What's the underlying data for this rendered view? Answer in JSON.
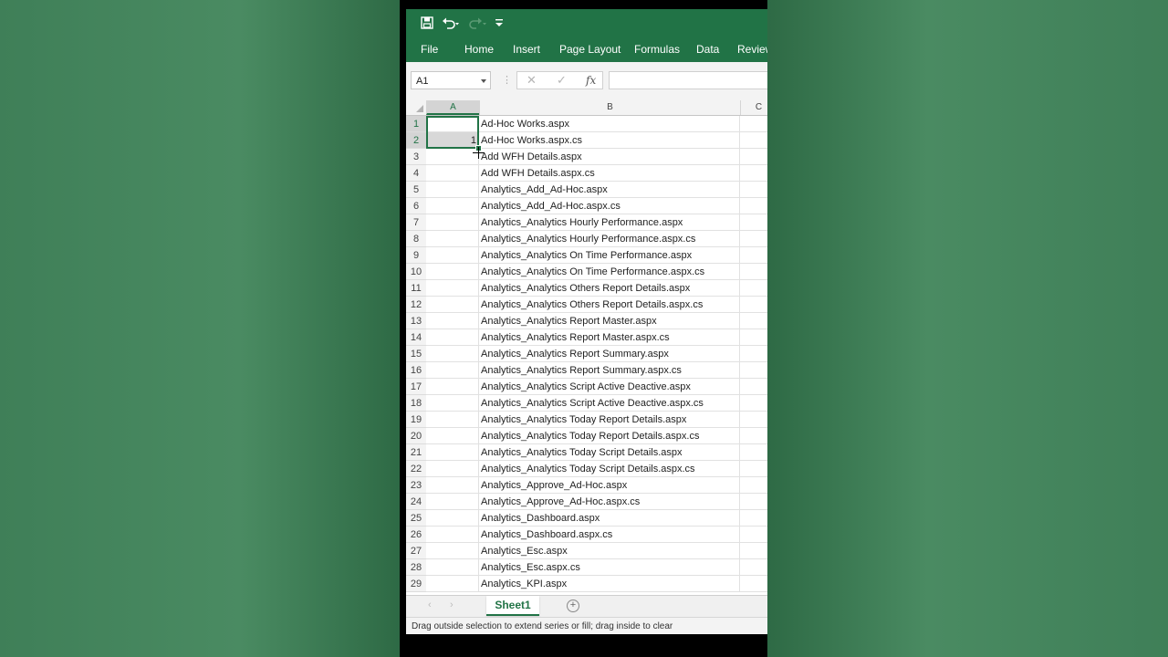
{
  "quick_access": {
    "icons": [
      "save-icon",
      "undo-icon",
      "redo-icon",
      "customize-icon"
    ]
  },
  "ribbon": {
    "tabs": [
      "File",
      "Home",
      "Insert",
      "Page Layout",
      "Formulas",
      "Data",
      "Review"
    ]
  },
  "formula_bar": {
    "name_box": "A1",
    "cancel_symbol": "✕",
    "enter_symbol": "✓",
    "fx_symbol": "fx",
    "formula_value": ""
  },
  "columns": [
    "A",
    "B",
    "C"
  ],
  "rows": [
    {
      "num": "1",
      "a": "",
      "b": "Ad-Hoc Works.aspx"
    },
    {
      "num": "2",
      "a": "1",
      "b": "Ad-Hoc Works.aspx.cs"
    },
    {
      "num": "3",
      "a": "",
      "b": "Add WFH Details.aspx"
    },
    {
      "num": "4",
      "a": "",
      "b": "Add WFH Details.aspx.cs"
    },
    {
      "num": "5",
      "a": "",
      "b": "Analytics_Add_Ad-Hoc.aspx"
    },
    {
      "num": "6",
      "a": "",
      "b": "Analytics_Add_Ad-Hoc.aspx.cs"
    },
    {
      "num": "7",
      "a": "",
      "b": "Analytics_Analytics Hourly Performance.aspx"
    },
    {
      "num": "8",
      "a": "",
      "b": "Analytics_Analytics Hourly Performance.aspx.cs"
    },
    {
      "num": "9",
      "a": "",
      "b": "Analytics_Analytics On Time Performance.aspx"
    },
    {
      "num": "10",
      "a": "",
      "b": "Analytics_Analytics On Time Performance.aspx.cs"
    },
    {
      "num": "11",
      "a": "",
      "b": "Analytics_Analytics Others Report Details.aspx"
    },
    {
      "num": "12",
      "a": "",
      "b": "Analytics_Analytics Others Report Details.aspx.cs"
    },
    {
      "num": "13",
      "a": "",
      "b": "Analytics_Analytics Report Master.aspx"
    },
    {
      "num": "14",
      "a": "",
      "b": "Analytics_Analytics Report Master.aspx.cs"
    },
    {
      "num": "15",
      "a": "",
      "b": "Analytics_Analytics Report Summary.aspx"
    },
    {
      "num": "16",
      "a": "",
      "b": "Analytics_Analytics Report Summary.aspx.cs"
    },
    {
      "num": "17",
      "a": "",
      "b": "Analytics_Analytics Script Active Deactive.aspx"
    },
    {
      "num": "18",
      "a": "",
      "b": "Analytics_Analytics Script Active Deactive.aspx.cs"
    },
    {
      "num": "19",
      "a": "",
      "b": "Analytics_Analytics Today Report Details.aspx"
    },
    {
      "num": "20",
      "a": "",
      "b": "Analytics_Analytics Today Report Details.aspx.cs"
    },
    {
      "num": "21",
      "a": "",
      "b": "Analytics_Analytics Today Script Details.aspx"
    },
    {
      "num": "22",
      "a": "",
      "b": "Analytics_Analytics Today Script Details.aspx.cs"
    },
    {
      "num": "23",
      "a": "",
      "b": "Analytics_Approve_Ad-Hoc.aspx"
    },
    {
      "num": "24",
      "a": "",
      "b": "Analytics_Approve_Ad-Hoc.aspx.cs"
    },
    {
      "num": "25",
      "a": "",
      "b": "Analytics_Dashboard.aspx"
    },
    {
      "num": "26",
      "a": "",
      "b": "Analytics_Dashboard.aspx.cs"
    },
    {
      "num": "27",
      "a": "",
      "b": "Analytics_Esc.aspx"
    },
    {
      "num": "28",
      "a": "",
      "b": "Analytics_Esc.aspx.cs"
    },
    {
      "num": "29",
      "a": "",
      "b": "Analytics_KPI.aspx"
    }
  ],
  "sheets": {
    "active": "Sheet1",
    "add_symbol": "+"
  },
  "status": {
    "message": "Drag outside selection to extend series or fill; drag inside to clear"
  },
  "colors": {
    "brand": "#217346",
    "background": "#4a8a60"
  }
}
